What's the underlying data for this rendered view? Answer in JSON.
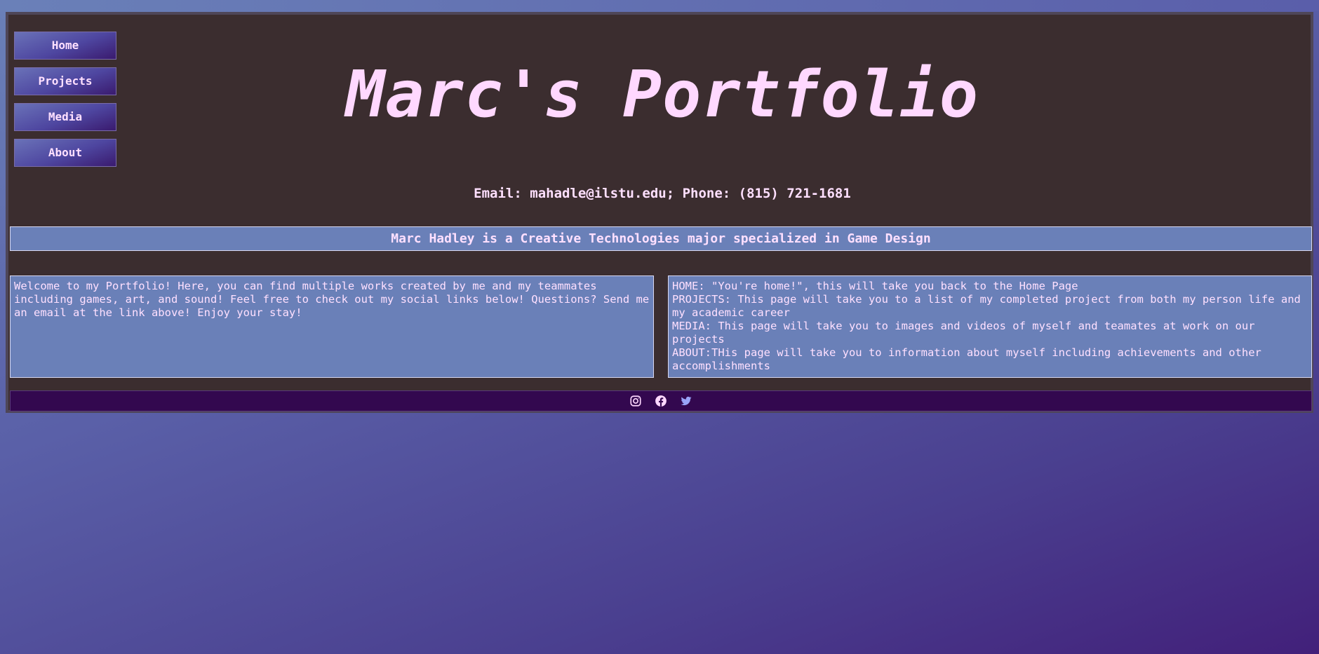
{
  "nav": {
    "items": [
      {
        "label": "Home"
      },
      {
        "label": "Projects"
      },
      {
        "label": "Media"
      },
      {
        "label": "About"
      }
    ]
  },
  "header": {
    "title": "Marc's Portfolio",
    "contact_prefix": "Email: ",
    "email": "mahadle@ilstu.edu",
    "contact_suffix": "; Phone: (815) 721-1681"
  },
  "tagline": "Marc Hadley is a Creative Technologies major specialized in Game Design",
  "welcome": {
    "text": "Welcome to my Portfolio! Here, you can find multiple works created by me and my teammates including games, art, and sound! Feel free to check out my social links below! Questions? Send me an email at the link above! Enjoy your stay!"
  },
  "guide": {
    "lines": [
      "HOME: \"You're home!\", this will take you back to the Home Page",
      "PROJECTS: This page will take you to a list of my completed project from both my person life and my academic career",
      "MEDIA: This page will take you to images and videos of myself and teamates at work on our projects",
      "ABOUT:THis page will take you to information about myself including achievements and other accomplishments"
    ]
  },
  "footer": {
    "icons": [
      "instagram-icon",
      "facebook-icon",
      "twitter-icon"
    ]
  },
  "colors": {
    "frame_bg": "#3b2d2f",
    "accent_text": "#ffd8ff",
    "panel_bg": "#6a80b8",
    "footer_bg": "#33084f"
  }
}
